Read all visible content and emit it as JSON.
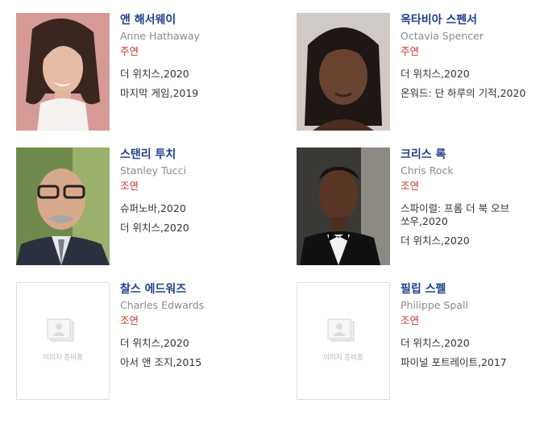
{
  "cast": [
    {
      "name_ko": "앤 해서웨이",
      "name_en": "Anne Hathaway",
      "role": "주연",
      "films": [
        "더 위치스,2020",
        "마지막 게임,2019"
      ],
      "photo": "anne-hathaway-photo",
      "has_photo": true
    },
    {
      "name_ko": "옥타비아 스펜서",
      "name_en": "Octavia Spencer",
      "role": "주연",
      "films": [
        "더 위치스,2020",
        "온워드: 단 하루의 기적,2020"
      ],
      "photo": "octavia-spencer-photo",
      "has_photo": true
    },
    {
      "name_ko": "스탠리 투치",
      "name_en": "Stanley Tucci",
      "role": "조연",
      "films": [
        "슈퍼노바,2020",
        "더 위치스,2020"
      ],
      "photo": "stanley-tucci-photo",
      "has_photo": true
    },
    {
      "name_ko": "크리스 록",
      "name_en": "Chris Rock",
      "role": "조연",
      "films": [
        "스파이럴: 프롬 더 북 오브 쏘우,2020",
        "더 위치스,2020"
      ],
      "photo": "chris-rock-photo",
      "has_photo": true
    },
    {
      "name_ko": "찰스 에드워즈",
      "name_en": "Charles Edwards",
      "role": "조연",
      "films": [
        "더 위치스,2020",
        "아서 앤 조지,2015"
      ],
      "photo": "no-image-placeholder",
      "has_photo": false
    },
    {
      "name_ko": "필립 스펠",
      "name_en": "Philippe Spall",
      "role": "조연",
      "films": [
        "더 위치스,2020",
        "파이널 포트레이트,2017"
      ],
      "photo": "no-image-placeholder",
      "has_photo": false
    }
  ],
  "placeholder_text": "이미지 준비중",
  "colors": {
    "name": "#1f3f8f",
    "english": "#8a8a8a",
    "role": "#c8342c",
    "film": "#333333"
  }
}
